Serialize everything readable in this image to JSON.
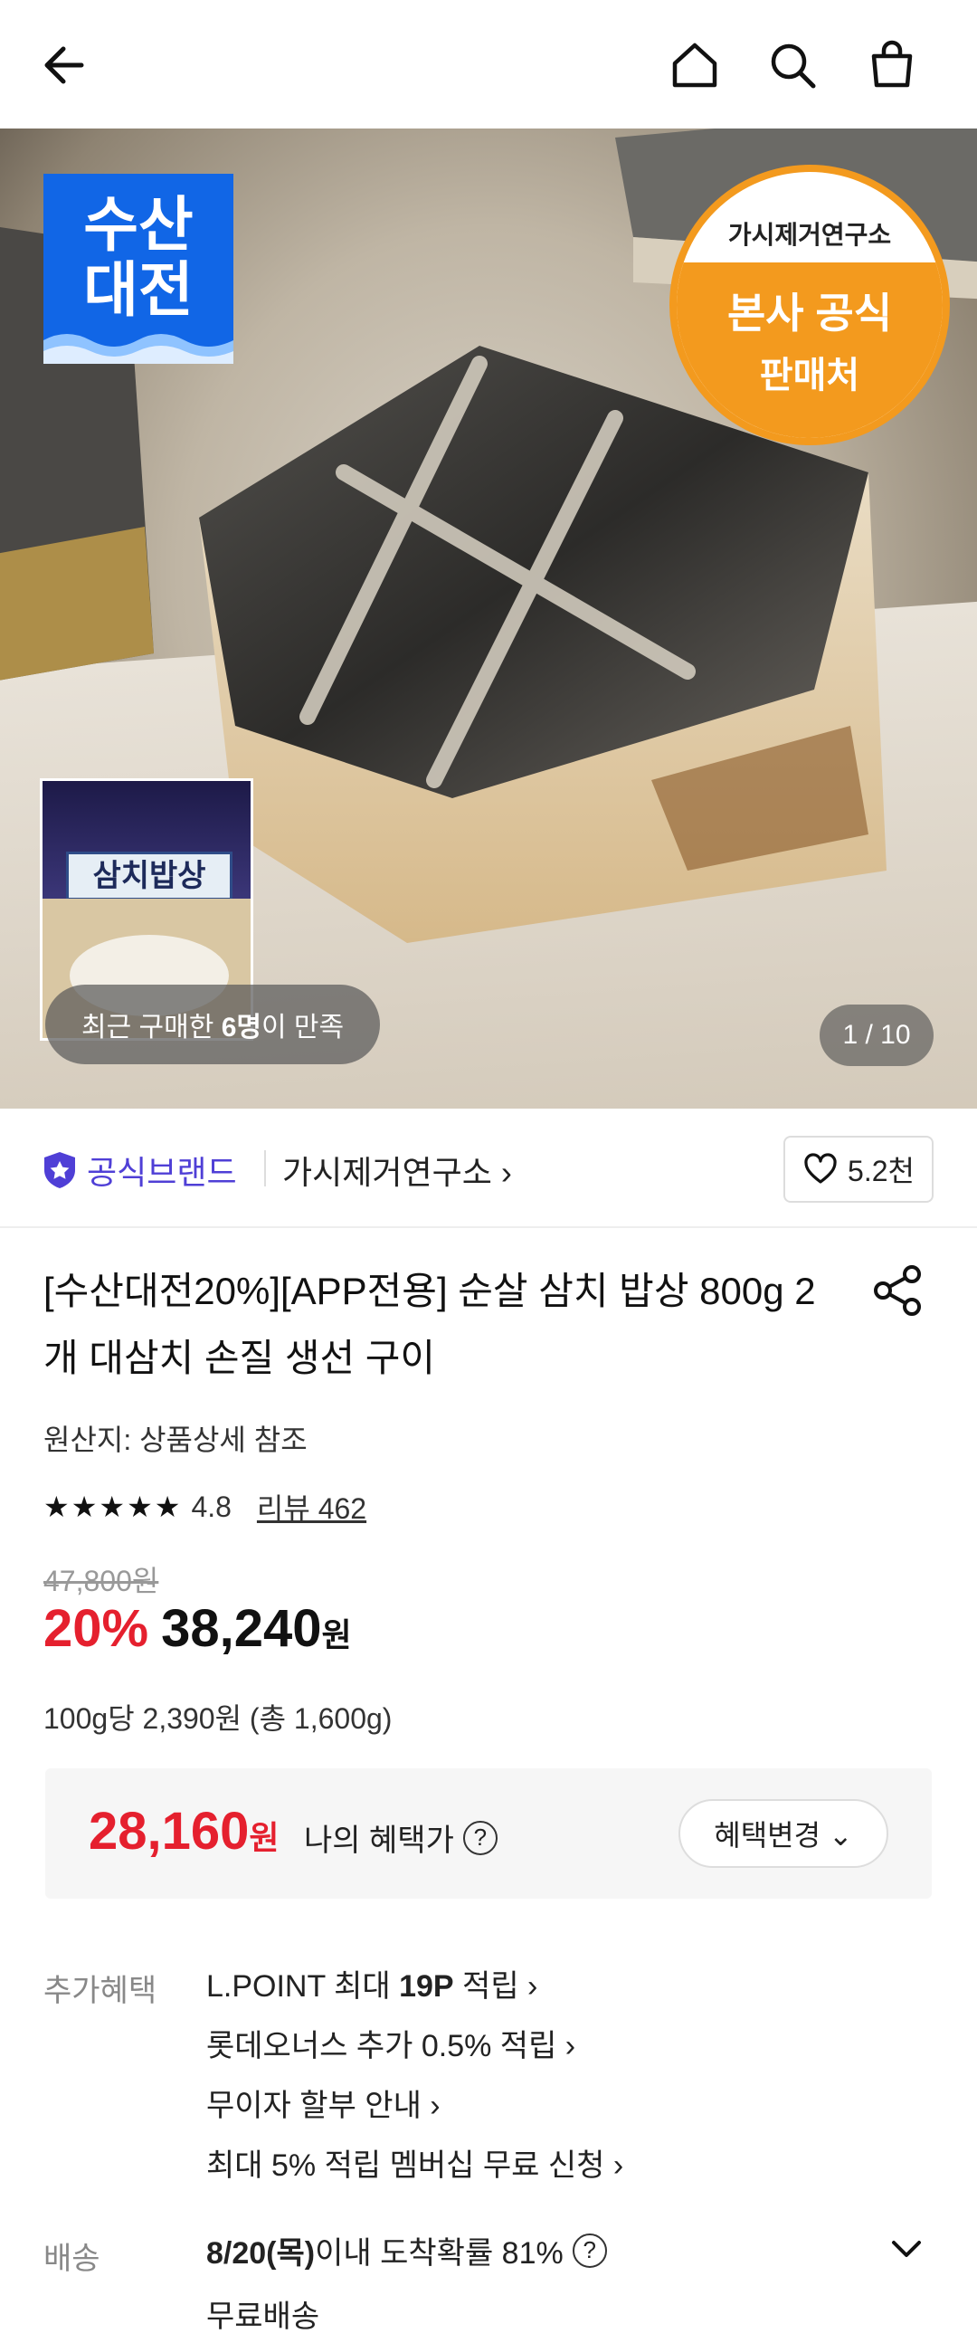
{
  "hero": {
    "badge_susan": "수산\n대전",
    "badge_official_brand": "가시제거연구소",
    "badge_official_line1": "본사 공식",
    "badge_official_line2": "판매처",
    "thumb_sign": "삼치밥상",
    "recent_prefix": "최근 구매한 ",
    "recent_count": "6명",
    "recent_suffix": "이 만족",
    "counter": "1 / 10"
  },
  "brand": {
    "official_label": "공식브랜드",
    "name": "가시제거연구소 ›",
    "likes": "5.2천"
  },
  "product": {
    "title": "[수산대전20%][APP전용] 순살 삼치 밥상 800g 2개 대삼치 손질 생선 구이",
    "origin": "원산지: 상품상세 참조",
    "stars": "★★★★★",
    "rating": "4.8",
    "review": "리뷰 462",
    "original_price": "47,800원",
    "discount": "20%",
    "price": "38,240",
    "won": "원",
    "unit_price": "100g당 2,390원 (총 1,600g)"
  },
  "benefit": {
    "price": "28,160",
    "won": "원",
    "label": "나의 혜택가",
    "qmark": "?",
    "button": "혜택변경 ⌄"
  },
  "extra": {
    "label": "추가혜택",
    "items": [
      {
        "pre": "L.POINT 최대 ",
        "bold": "19P",
        "post": " 적립 ›"
      },
      {
        "pre": "롯데오너스 추가 0.5% 적립 ›",
        "bold": "",
        "post": ""
      },
      {
        "pre": "무이자 할부 안내 ›",
        "bold": "",
        "post": ""
      },
      {
        "pre": "최대 5% 적립 멤버십 무료 신청 ›",
        "bold": "",
        "post": ""
      }
    ]
  },
  "shipping": {
    "label": "배송",
    "date": "8/20(목)",
    "rest": " 이내 도착확률 81%",
    "qmark": "?",
    "sub": "무료배송"
  },
  "colors": {
    "accent_red": "#e5202e",
    "brand_purple": "#4f3fd6",
    "susan_blue": "#1166e6",
    "official_orange": "#f39a1e"
  }
}
